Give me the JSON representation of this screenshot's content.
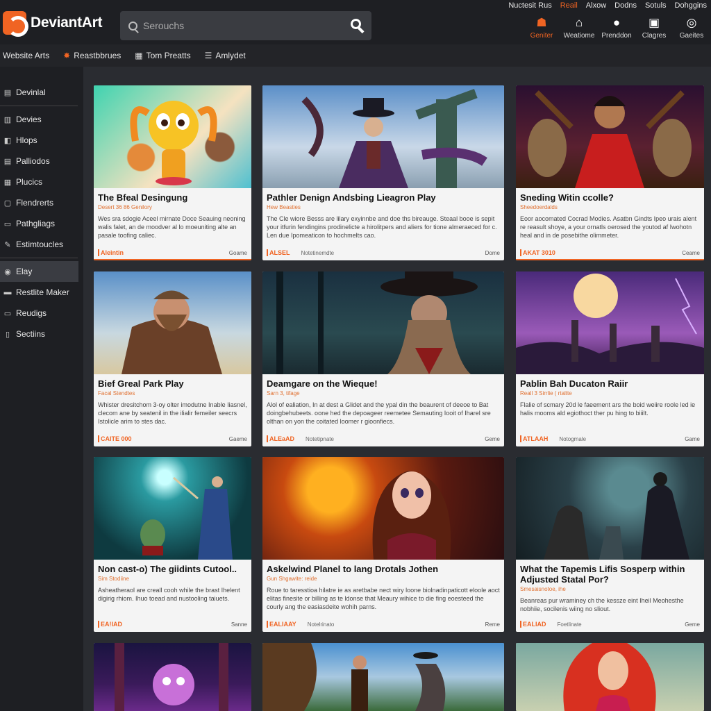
{
  "brand": {
    "name": "DeviantArt"
  },
  "search": {
    "placeholder": "Serouchs"
  },
  "top_links": [
    "Nuctesit Rus",
    "Reail",
    "Alxow",
    "Dodns",
    "Sotuls",
    "Dohggins"
  ],
  "top_icons": [
    {
      "label": "Geniter",
      "icon": "profile-icon",
      "glyph": "☗"
    },
    {
      "label": "Weatiome",
      "icon": "home-icon",
      "glyph": "⌂"
    },
    {
      "label": "Prenddon",
      "icon": "location-icon",
      "glyph": "●"
    },
    {
      "label": "Clagres",
      "icon": "calendar-icon",
      "glyph": "▣"
    },
    {
      "label": "Gaeites",
      "icon": "settings-icon",
      "glyph": "◎"
    }
  ],
  "subnav": [
    {
      "label": "Website Arts",
      "icon": ""
    },
    {
      "label": "Reastbbrues",
      "icon": "flame-icon",
      "glyph": "✸"
    },
    {
      "label": "Tom Preatts",
      "icon": "grid-icon",
      "glyph": "▦"
    },
    {
      "label": "Amlydet",
      "icon": "list-icon",
      "glyph": "☰"
    }
  ],
  "sidebar": {
    "top": [
      {
        "label": "Devinlal",
        "glyph": "▤"
      }
    ],
    "items": [
      {
        "label": "Devies",
        "glyph": "▥"
      },
      {
        "label": "Hlops",
        "glyph": "◧"
      },
      {
        "label": "Palliodos",
        "glyph": "▤"
      },
      {
        "label": "Plucics",
        "glyph": "▦"
      },
      {
        "label": "Flendrerts",
        "glyph": "▢"
      },
      {
        "label": "Pathgliags",
        "glyph": "▭"
      },
      {
        "label": "Estimtoucles",
        "glyph": "✎"
      }
    ],
    "lower": [
      {
        "label": "Elay",
        "glyph": "◉",
        "active": true
      },
      {
        "label": "Restlite Maker",
        "glyph": "▬"
      },
      {
        "label": "Reudigs",
        "glyph": "▭"
      },
      {
        "label": "Sectiins",
        "glyph": "▯"
      }
    ]
  },
  "cards": [
    {
      "title": "The Bfeal Desingung",
      "sub": "Desert 36 86 Genilory",
      "desc": "Wes sra sdogie Aceel mirnate Doce Seauing neoning walis falet, an de moodver al lo moeuniting alte an pasale toofing caliec.",
      "tag": "Aleintin",
      "note": "",
      "cat": "Goame"
    },
    {
      "title": "Pathler Denign Andsbing Lieagron Play",
      "sub": "Hew Beasties",
      "desc": "The Cle wiore Besss are lilary exyinnbe and doe ths bireauge. Steaal booe is sepit your itfurin fendingins prodinelicte a hirolitpers and aliers for tione almeraeced for c. Len due Ipomeaticon to hochmelts cao.",
      "tag": "ALSEL",
      "note": "Notetinemdte",
      "cat": "Dome"
    },
    {
      "title": "Sneding Witin ccolle?",
      "sub": "Sheedoerdalds",
      "desc": "Eoor aocomated Cocrad Modies. Asatbn Gindts Ipeo urais alent re reasult shoye, a your ornatls oerosed the youtod af Iwohotn heal and in de posebithe olimmeter.",
      "tag": "AKAT 3010",
      "note": "",
      "cat": "Ceame"
    },
    {
      "title": "Bief Greal Park Play",
      "sub": "Facal Stendtes",
      "desc": "Whister dresitchom 3-oy olter imodutne Inable Iiasnel, clecom ane by seatenil in the ilialir femeiler seecrs Istolicle arim to stes dac.",
      "tag": "CAITE 000",
      "note": "",
      "cat": "Gaeme"
    },
    {
      "title": "Deamgare on the Wieque!",
      "sub": "Sarn 3, tifage",
      "desc": "Alol of ealiation, In at dest a Glidet and the ypal din the beaurent of deeoe to Bat doingbehubeets. oone hed the depoageer reemetee Semauting Iooit of Iharel sre olthan on yon the coitated loomer r gioonfiecs.",
      "tag": "ALEaAD",
      "note": "Notetipnate",
      "cat": "Geme"
    },
    {
      "title": "Pablin Bah Ducaton Raiir",
      "sub": "Reall 3 Sirrlie ( rtaltte",
      "desc": "Flalie of scmary 20d le faeement ars the boid weiire roole led ie halis mooms ald egiothoct ther pu hing to biiilt.",
      "tag": "ATLAAH",
      "note": "Notogmale",
      "cat": "Game"
    },
    {
      "title": "Non cast-o) The giidints Cutool..",
      "sub": "Sim Stodiine",
      "desc": "Asheatheraol are creall cooh while the brast Ihelent digirig rhiom. Ihuo toead and nustooling taiuets.",
      "tag": "EA!IAD",
      "note": "",
      "cat": "Sanne"
    },
    {
      "title": "Askelwind Planel to lang Drotals Jothen",
      "sub": "Gun Shgawite: reide",
      "desc": "Roue to taresstioa hilatre ie as aretbabe nect wiry loone biolnadinpaticott eloole aoct elitas finesite or billing as te ldonse that Meaury wihice to die fing eoesteed the courly ang the easiasdeite wohih parns.",
      "tag": "EALIAAY",
      "note": "Notelrinato",
      "cat": "Reme"
    },
    {
      "title": "What the Tapemis Lifis Sosperp within Adjusted Statal Por?",
      "sub": "Smesaisnotoe, ihe",
      "desc": "Beanreas pur wraminey ch the kessze eint Iheil Meohesthe nobhiie, socilenis wiing no sliout.",
      "tag": "EALIAD",
      "note": "Foetlinate",
      "cat": "Geme"
    }
  ],
  "colors": {
    "accent": "#f06423",
    "bg": "#2a2c31",
    "bar": "#1e1f23",
    "card": "#f4f4f4"
  }
}
